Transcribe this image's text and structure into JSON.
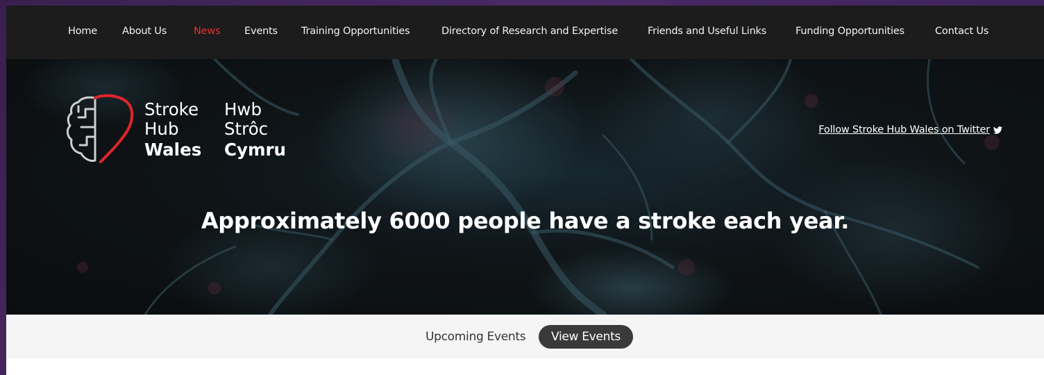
{
  "nav": {
    "items": [
      {
        "label": "Home"
      },
      {
        "label": "About Us"
      },
      {
        "label": "News",
        "active": true
      },
      {
        "label": "Events"
      },
      {
        "label": "Training Opportunities"
      },
      {
        "label": "Directory of Research and Expertise"
      },
      {
        "label": "Friends and Useful Links"
      },
      {
        "label": "Funding Opportunities"
      },
      {
        "label": "Contact Us"
      }
    ],
    "active_color": "#d9342b"
  },
  "logo": {
    "english": {
      "line1": "Stroke",
      "line2": "Hub",
      "line3": "Wales"
    },
    "welsh": {
      "line1": "Hwb",
      "line2": "Strôc",
      "line3": "Cymru"
    },
    "heart_color": "#e0262b",
    "icon": "brain-heart-icon"
  },
  "hero": {
    "twitter_link": "Follow Stroke Hub Wales on Twitter",
    "twitter_icon": "twitter-bird-icon",
    "headline": "Approximately 6000 people have a stroke each year."
  },
  "events": {
    "label": "Upcoming Events",
    "button": "View Events"
  }
}
